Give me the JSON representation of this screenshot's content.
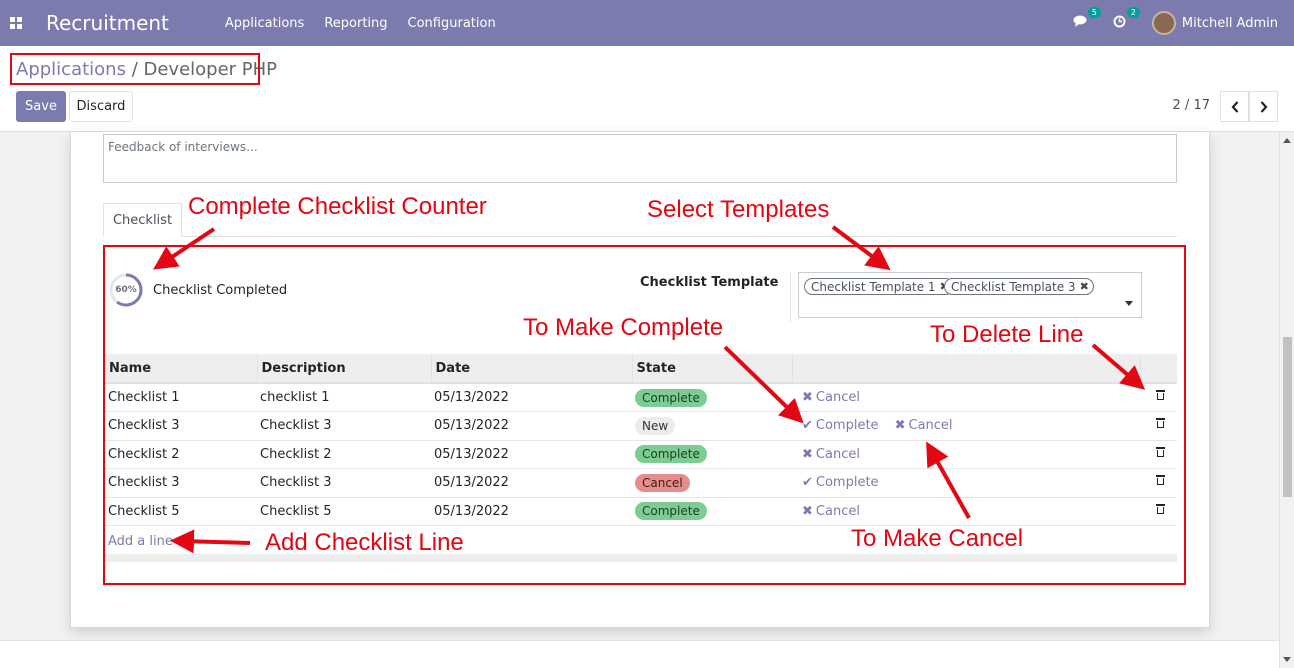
{
  "navbar": {
    "brand": "Recruitment",
    "menu": [
      "Applications",
      "Reporting",
      "Configuration"
    ],
    "messages_badge": "5",
    "activities_badge": "2",
    "user": "Mitchell Admin"
  },
  "breadcrumb": {
    "parent": "Applications",
    "separator": "/",
    "current": "Developer PHP"
  },
  "buttons": {
    "save": "Save",
    "discard": "Discard"
  },
  "pager": {
    "text": "2 / 17"
  },
  "form": {
    "feedback_placeholder": "Feedback of interviews...",
    "tab": "Checklist",
    "progress_value": "60%",
    "progress_fraction": 0.6,
    "progress_label": "Checklist Completed",
    "template_label": "Checklist Template",
    "template_tags": [
      "Checklist Template 1",
      "Checklist Template 3"
    ]
  },
  "table": {
    "headers": [
      "Name",
      "Description",
      "Date",
      "State"
    ],
    "rows": [
      {
        "name": "Checklist 1",
        "description": "checklist 1",
        "date": "05/13/2022",
        "state": "Complete"
      },
      {
        "name": "Checklist 3",
        "description": "Checklist 3",
        "date": "05/13/2022",
        "state": "New"
      },
      {
        "name": "Checklist 2",
        "description": "Checklist 2",
        "date": "05/13/2022",
        "state": "Complete"
      },
      {
        "name": "Checklist 3",
        "description": "Checklist 3",
        "date": "05/13/2022",
        "state": "Cancel"
      },
      {
        "name": "Checklist 5",
        "description": "Checklist 5",
        "date": "05/13/2022",
        "state": "Complete"
      }
    ],
    "action_complete": "Complete",
    "action_cancel": "Cancel",
    "add_line": "Add a line"
  },
  "annotations": {
    "counter": "Complete Checklist Counter",
    "templates": "Select Templates",
    "make_complete": "To Make Complete",
    "delete_line": "To Delete Line",
    "add_line": "Add Checklist Line",
    "make_cancel": "To Make Cancel"
  },
  "colors": {
    "primary": "#7c7bad",
    "annotation": "#e30613",
    "complete": "#7dcc94",
    "cancel": "#e58c8c"
  }
}
